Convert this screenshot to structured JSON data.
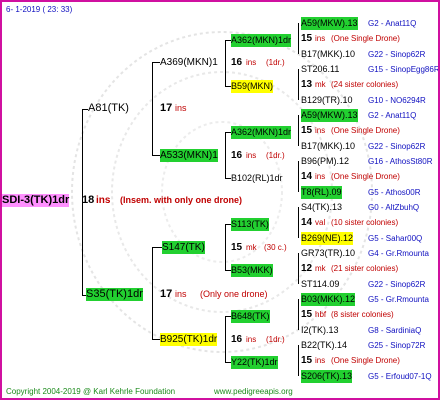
{
  "header": "6-  1-2019 ( 23: 33)",
  "root": {
    "name": "SDI-3(TK)1dr",
    "num": "18",
    "ins": "ins",
    "note": "(Insem. with only one drone)"
  },
  "gen1": [
    {
      "name": "A81(TK)",
      "num": "17",
      "ins": "ins"
    },
    {
      "name": "S35(TK)1dr",
      "num": "17",
      "ins": "ins",
      "note": "(Only one drone)"
    }
  ],
  "gen2": [
    {
      "name": "A369(MKN)1",
      "num": "16",
      "ins": "ins",
      "note": "(1dr.)"
    },
    {
      "name": "A533(MKN)1",
      "num": "16",
      "ins": "ins",
      "note": "(1dr.)"
    },
    {
      "name": "S147(TK)",
      "num": "15",
      "ins": "mk",
      "note": "(30 c.)"
    },
    {
      "name": "B925(TK)1dr",
      "num": "16",
      "ins": "ins",
      "note": "(1dr.)"
    }
  ],
  "gen3": [
    {
      "name": "A362(MKN)1dr",
      "note": ""
    },
    {
      "name": "B59(MKN)",
      "note": ""
    },
    {
      "name": "A362(MKN)1dr",
      "note": ""
    },
    {
      "name": "B102(RL)1dr",
      "note": ""
    },
    {
      "name": "S113(TK)",
      "note": ""
    },
    {
      "name": "B53(MKK)",
      "note": ""
    },
    {
      "name": "B648(TK)",
      "note": ""
    },
    {
      "name": "Y22(TK)1dr",
      "note": ""
    }
  ],
  "gen4": [
    {
      "l1": "A59(MKW).13",
      "l1r": "G2 - Anat11Q",
      "mid_num": "15",
      "mid_ins": "ins",
      "mid": "(One Single Drone)",
      "l3": "B17(MKK).10",
      "l3r": "G22 - Sinop62R"
    },
    {
      "l1": "ST206.11",
      "l1r": "G15 - SinopEgg86R",
      "mid_num": "13",
      "mid_ins": "mk",
      "mid": "(24 sister colonies)",
      "l3": "B129(TR).10",
      "l3r": "G10 - NO6294R"
    },
    {
      "l1": "A59(MKW).13",
      "l1r": "G2 - Anat11Q",
      "mid_num": "15",
      "mid_ins": "ins",
      "mid": "(One Single Drone)",
      "l3": "B17(MKK).10",
      "l3r": "G22 - Sinop62R"
    },
    {
      "l1": "B96(PM).12",
      "l1r": "G16 - AthosSt80R",
      "mid_num": "14",
      "mid_ins": "ins",
      "mid": "(One Single Drone)",
      "l3": "T8(RL).09",
      "l3r": "G5 - Athos00R"
    },
    {
      "l1": "S4(TK).13",
      "l1r": "G0 - AltZbuhQ",
      "mid_num": "14",
      "mid_ins": "val",
      "mid": "(10 sister colonies)",
      "l3": "B269(NE).12",
      "l3r": "G5 - Sahar00Q"
    },
    {
      "l1": "GR73(TR).10",
      "l1r": "G4 - Gr.Rmounta",
      "mid_num": "12",
      "mid_ins": "mk",
      "mid": "(21 sister colonies)",
      "l3": "ST114.09",
      "l3r": "G22 - Sinop62R"
    },
    {
      "l1": "B03(MKK).12",
      "l1r": "G5 - Gr.Rmounta",
      "mid_num": "15",
      "mid_ins": "hbf",
      "mid": "(8 sister colonies)",
      "l3": "I2(TK).13",
      "l3r": "G8 - SardiniaQ"
    },
    {
      "l1": "B22(TK).14",
      "l1r": "G25 - Sinop72R",
      "mid_num": "15",
      "mid_ins": "ins",
      "mid": "(One Single Drone)",
      "l3": "S206(TK).13",
      "l3r": "G5 - Erfoud07-1Q"
    }
  ],
  "footer": {
    "copyright": "Copyright 2004-2019 @ Karl Kehrle Foundation",
    "url": "www.pedigreeapis.org"
  },
  "colors": {
    "frame": "#d010a0",
    "green": "#22d030",
    "yellow": "#ffff00",
    "pink": "#ff90ff",
    "ins": "#c00000",
    "blue": "#1010c0",
    "footer": "#1a8a1a"
  }
}
